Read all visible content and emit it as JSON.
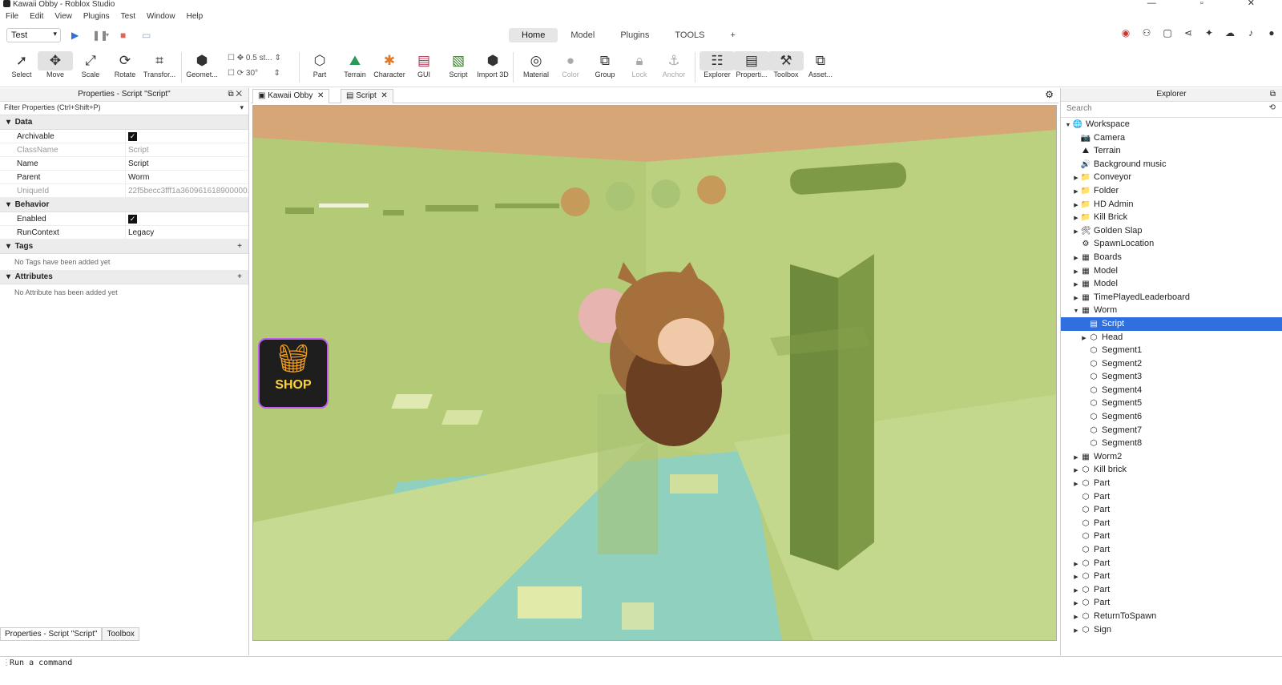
{
  "window": {
    "title": "Kawaii Obby - Roblox Studio",
    "controls": "— ▫ ✕"
  },
  "menu": [
    "File",
    "Edit",
    "View",
    "Plugins",
    "Test",
    "Window",
    "Help"
  ],
  "mode": {
    "value": "Test"
  },
  "ribbon_tabs": [
    "Home",
    "Model",
    "Plugins",
    "TOOLS",
    "+"
  ],
  "tools": [
    "Select",
    "Move",
    "Scale",
    "Rotate",
    "Transfor...",
    "Geomet...",
    "Part",
    "Terrain",
    "Character",
    "GUI",
    "Script",
    "Import 3D",
    "Material",
    "Color",
    "Group",
    "Lock",
    "Anchor",
    "Explorer",
    "Properti...",
    "Toolbox",
    "Asset..."
  ],
  "snap": {
    "move": "0.5 st...",
    "rotate": "30°"
  },
  "properties": {
    "title": "Properties - Script \"Script\"",
    "filter": "Filter Properties (Ctrl+Shift+P)",
    "data_header": "Data",
    "data_rows": [
      {
        "k": "Archivable",
        "v": "✓"
      },
      {
        "k": "ClassName",
        "v": "Script"
      },
      {
        "k": "Name",
        "v": "Script"
      },
      {
        "k": "Parent",
        "v": "Worm"
      },
      {
        "k": "UniqueId",
        "v": "22f5becc3fff1a360961618900000..."
      }
    ],
    "behavior_header": "Behavior",
    "behavior_rows": [
      {
        "k": "Enabled",
        "v": "✓"
      },
      {
        "k": "RunContext",
        "v": "Legacy"
      }
    ],
    "tags_header": "Tags",
    "tags_empty": "No Tags have been added yet",
    "attributes_header": "Attributes",
    "attributes_empty": "No Attribute has been added yet",
    "bottom_tabs": [
      "Properties - Script \"Script\"",
      "Toolbox"
    ]
  },
  "doc_tabs": [
    "Kawaii Obby",
    "Script"
  ],
  "viewport": {
    "shop_label": "SHOP"
  },
  "explorer": {
    "title": "Explorer",
    "search_placeholder": "Search",
    "items": [
      {
        "n": "Workspace",
        "l": 0,
        "a": "▼",
        "i": "🌐"
      },
      {
        "n": "Camera",
        "l": 1,
        "a": "",
        "i": "📷"
      },
      {
        "n": "Terrain",
        "l": 1,
        "a": "",
        "i": "⛰"
      },
      {
        "n": "Background music",
        "l": 1,
        "a": "",
        "i": "🔊"
      },
      {
        "n": "Conveyor",
        "l": 1,
        "a": "▶",
        "i": "📁"
      },
      {
        "n": "Folder",
        "l": 1,
        "a": "▶",
        "i": "📁"
      },
      {
        "n": "HD Admin",
        "l": 1,
        "a": "▶",
        "i": "📁"
      },
      {
        "n": "Kill Brick",
        "l": 1,
        "a": "▶",
        "i": "📁"
      },
      {
        "n": "Golden Slap",
        "l": 1,
        "a": "▶",
        "i": "🛠"
      },
      {
        "n": "SpawnLocation",
        "l": 1,
        "a": "",
        "i": "⚙"
      },
      {
        "n": "Boards",
        "l": 1,
        "a": "▶",
        "i": "▦"
      },
      {
        "n": "Model",
        "l": 1,
        "a": "▶",
        "i": "▦"
      },
      {
        "n": "Model",
        "l": 1,
        "a": "▶",
        "i": "▦"
      },
      {
        "n": "TimePlayedLeaderboard",
        "l": 1,
        "a": "▶",
        "i": "▦"
      },
      {
        "n": "Worm",
        "l": 1,
        "a": "▼",
        "i": "▦"
      },
      {
        "n": "Script",
        "l": 2,
        "a": "",
        "i": "▤",
        "sel": true
      },
      {
        "n": "Head",
        "l": 2,
        "a": "▶",
        "i": "⬡"
      },
      {
        "n": "Segment1",
        "l": 2,
        "a": "",
        "i": "⬡"
      },
      {
        "n": "Segment2",
        "l": 2,
        "a": "",
        "i": "⬡"
      },
      {
        "n": "Segment3",
        "l": 2,
        "a": "",
        "i": "⬡"
      },
      {
        "n": "Segment4",
        "l": 2,
        "a": "",
        "i": "⬡"
      },
      {
        "n": "Segment5",
        "l": 2,
        "a": "",
        "i": "⬡"
      },
      {
        "n": "Segment6",
        "l": 2,
        "a": "",
        "i": "⬡"
      },
      {
        "n": "Segment7",
        "l": 2,
        "a": "",
        "i": "⬡"
      },
      {
        "n": "Segment8",
        "l": 2,
        "a": "",
        "i": "⬡"
      },
      {
        "n": "Worm2",
        "l": 1,
        "a": "▶",
        "i": "▦"
      },
      {
        "n": "Kill brick",
        "l": 1,
        "a": "▶",
        "i": "⬡"
      },
      {
        "n": "Part",
        "l": 1,
        "a": "▶",
        "i": "⬡"
      },
      {
        "n": "Part",
        "l": 1,
        "a": "",
        "i": "⬡"
      },
      {
        "n": "Part",
        "l": 1,
        "a": "",
        "i": "⬡"
      },
      {
        "n": "Part",
        "l": 1,
        "a": "",
        "i": "⬡"
      },
      {
        "n": "Part",
        "l": 1,
        "a": "",
        "i": "⬡"
      },
      {
        "n": "Part",
        "l": 1,
        "a": "",
        "i": "⬡"
      },
      {
        "n": "Part",
        "l": 1,
        "a": "▶",
        "i": "⬡"
      },
      {
        "n": "Part",
        "l": 1,
        "a": "▶",
        "i": "⬡"
      },
      {
        "n": "Part",
        "l": 1,
        "a": "▶",
        "i": "⬡"
      },
      {
        "n": "Part",
        "l": 1,
        "a": "▶",
        "i": "⬡"
      },
      {
        "n": "ReturnToSpawn",
        "l": 1,
        "a": "▶",
        "i": "⬡"
      },
      {
        "n": "Sign",
        "l": 1,
        "a": "▶",
        "i": "⬡"
      }
    ]
  },
  "command_bar": {
    "placeholder": "Run a command"
  },
  "colors": {
    "accent": "#2f6fe0",
    "viewport_green": "#b6cc79",
    "water": "#8ccfc0",
    "ceiling": "#d4a474"
  }
}
